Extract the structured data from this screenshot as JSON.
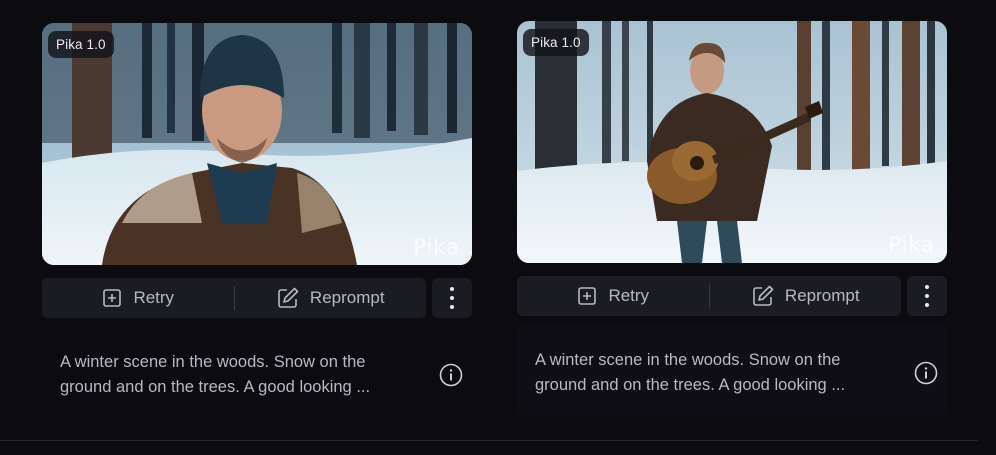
{
  "cards": [
    {
      "badge": "Pika 1.0",
      "watermark": "Pika",
      "retry_label": "Retry",
      "reprompt_label": "Reprompt",
      "description": "A winter scene in the woods. Snow on the ground and on the trees. A good looking ..."
    },
    {
      "badge": "Pika 1.0",
      "watermark": "Pika",
      "retry_label": "Retry",
      "reprompt_label": "Reprompt",
      "description": "A winter scene in the woods. Snow on the ground and on the trees. A good looking ..."
    }
  ],
  "colors": {
    "background": "#0b0b10",
    "button_bg": "#1b1c22",
    "text": "#b8b8c2"
  }
}
